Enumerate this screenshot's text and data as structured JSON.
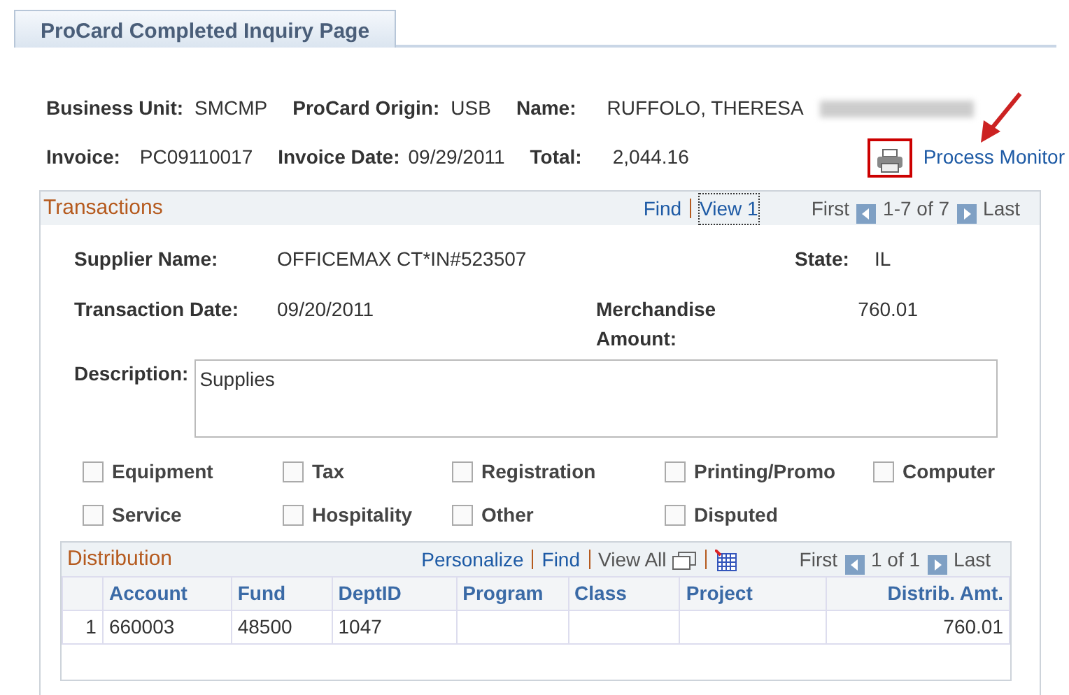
{
  "tab": {
    "label": "ProCard Completed Inquiry Page",
    "selected": true
  },
  "header": {
    "rows": [
      [
        {
          "label": "Business Unit:",
          "value": "SMCMP"
        },
        {
          "label": "ProCard Origin:",
          "value": "USB"
        },
        {
          "label": "Name:",
          "value": "RUFFOLO, THERESA"
        }
      ],
      [
        {
          "label": "Invoice:",
          "value": "PC09110017"
        },
        {
          "label": "Invoice Date:",
          "value": "09/29/2011"
        },
        {
          "label": "Total:",
          "value": "2,044.16"
        }
      ]
    ],
    "process_monitor": "Process Monitor"
  },
  "transactions": {
    "title": "Transactions",
    "find": "Find",
    "view": "View 1",
    "first": "First",
    "range": "1-7 of 7",
    "last": "Last",
    "supplier_label": "Supplier Name:",
    "supplier": "OFFICEMAX CT*IN#523507",
    "state_label": "State:",
    "state": "IL",
    "date_label": "Transaction Date:",
    "date": "09/20/2011",
    "amount_label": "Merchandise Amount:",
    "amount": "760.01",
    "description_label": "Description:",
    "description": "Supplies",
    "checkboxes": [
      {
        "label": "Equipment",
        "checked": false
      },
      {
        "label": "Tax",
        "checked": false
      },
      {
        "label": "Registration",
        "checked": false
      },
      {
        "label": "Printing/Promo",
        "checked": false
      },
      {
        "label": "Computer",
        "checked": false
      },
      {
        "label": "Service",
        "checked": false
      },
      {
        "label": "Hospitality",
        "checked": false
      },
      {
        "label": "Other",
        "checked": false
      },
      {
        "label": "Disputed",
        "checked": false
      }
    ]
  },
  "distribution": {
    "title": "Distribution",
    "personalize": "Personalize",
    "find": "Find",
    "view_all": "View All",
    "first": "First",
    "range": "1 of 1",
    "last": "Last",
    "columns": [
      "",
      "Account",
      "Fund",
      "DeptID",
      "Program",
      "Class",
      "Project",
      "Distrib. Amt."
    ],
    "rows": [
      [
        "1",
        "660003",
        "48500",
        "1047",
        "",
        "",
        "",
        "760.01"
      ]
    ]
  }
}
